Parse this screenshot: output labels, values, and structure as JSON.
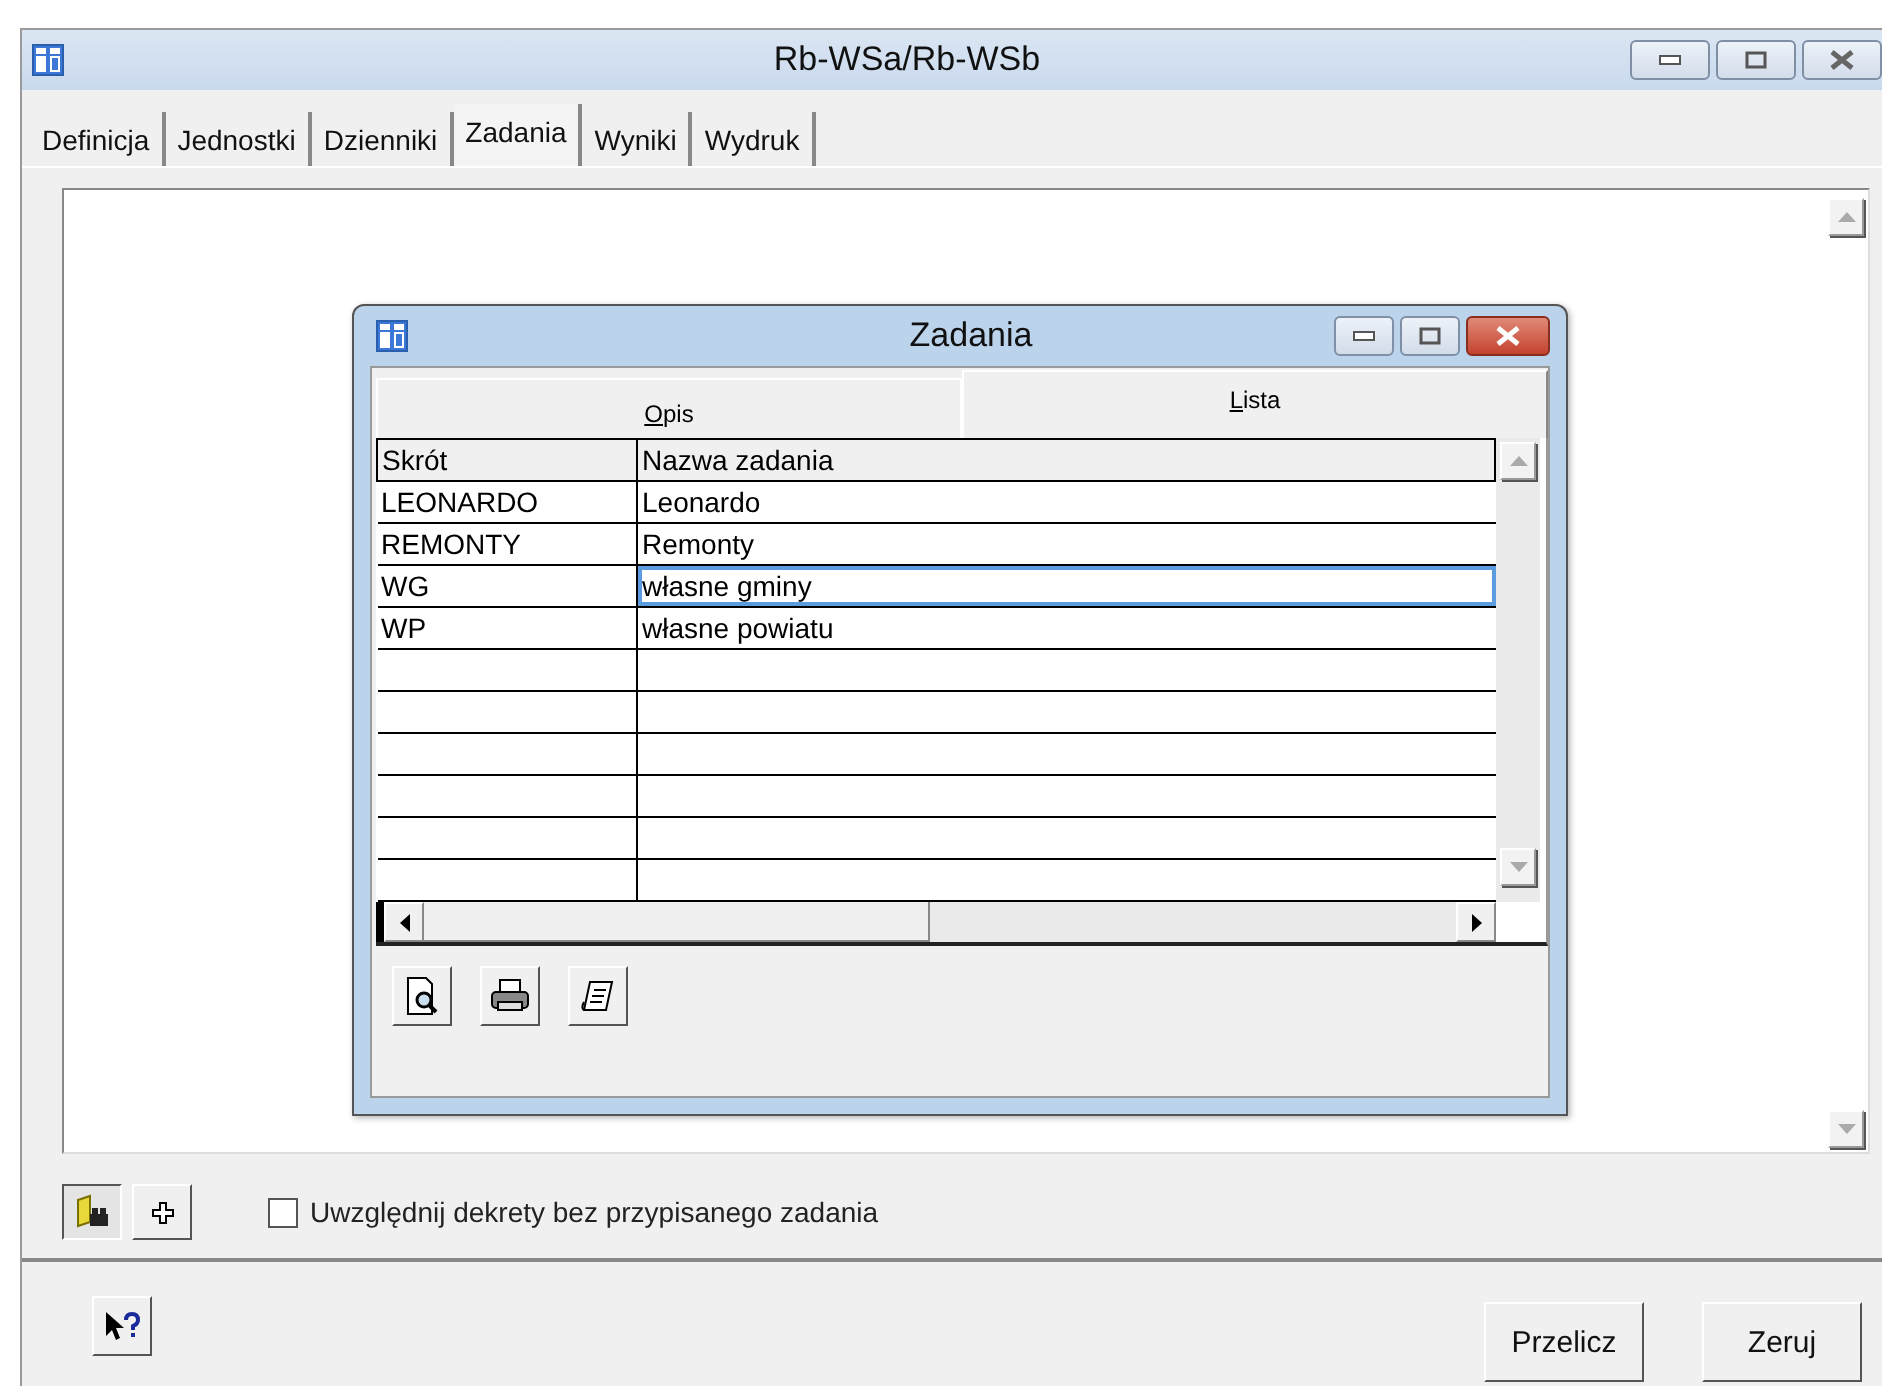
{
  "window": {
    "title": "Rb-WSa/Rb-WSb"
  },
  "tabs": [
    {
      "label": "Definicja",
      "selected": false
    },
    {
      "label": "Jednostki",
      "selected": false
    },
    {
      "label": "Dzienniki",
      "selected": false
    },
    {
      "label": "Zadania",
      "selected": true
    },
    {
      "label": "Wyniki",
      "selected": false
    },
    {
      "label": "Wydruk",
      "selected": false
    }
  ],
  "dialog": {
    "title": "Zadania",
    "tabs": [
      {
        "label": "Opis",
        "selected": false
      },
      {
        "label": "Lista",
        "selected": true
      }
    ],
    "table": {
      "columns": [
        "Skrót",
        "Nazwa zadania"
      ],
      "rows": [
        {
          "cells": [
            "LEONARDO",
            "Leonardo"
          ],
          "selected": false
        },
        {
          "cells": [
            "REMONTY",
            "Remonty"
          ],
          "selected": false
        },
        {
          "cells": [
            "WG",
            "własne gminy"
          ],
          "selected": true
        },
        {
          "cells": [
            "WP",
            "własne powiatu"
          ],
          "selected": false
        }
      ]
    }
  },
  "options": {
    "checkbox": {
      "label": "Uwzględnij dekrety bez przypisanego zadania",
      "checked": false
    }
  },
  "buttons": [
    "Przelicz",
    "Zeruj"
  ]
}
